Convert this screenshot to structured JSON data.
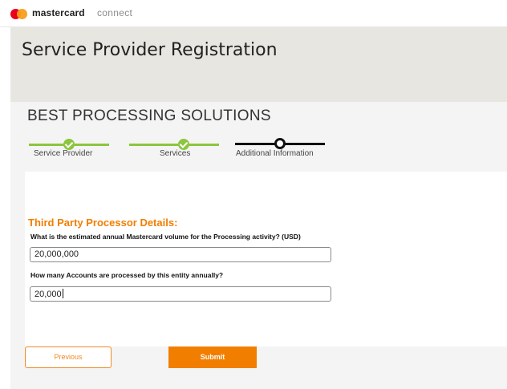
{
  "header": {
    "brand_name": "mastercard",
    "brand_suffix": "connect",
    "logo_colors": {
      "red": "#eb001b",
      "yellow": "#f79e1b"
    }
  },
  "page": {
    "title": "Service Provider Registration"
  },
  "company_name": "BEST PROCESSING SOLUTIONS",
  "stepper": {
    "colors": {
      "done": "#8cc63e",
      "current": "#111111"
    },
    "steps": [
      {
        "label": "Service Provider",
        "state": "done"
      },
      {
        "label": "Services",
        "state": "done"
      },
      {
        "label": "Additional Information",
        "state": "current"
      }
    ]
  },
  "form": {
    "section_title": "Third Party Processor Details:",
    "accent_color": "#f27e00",
    "questions": [
      {
        "label": "What is the estimated annual Mastercard volume for the Processing activity? (USD)",
        "value": "20,000,000"
      },
      {
        "label": "How many Accounts are processed by this entity annually?",
        "value": "20,000"
      }
    ]
  },
  "buttons": {
    "previous_label": "Previous",
    "submit_label": "Submit"
  }
}
